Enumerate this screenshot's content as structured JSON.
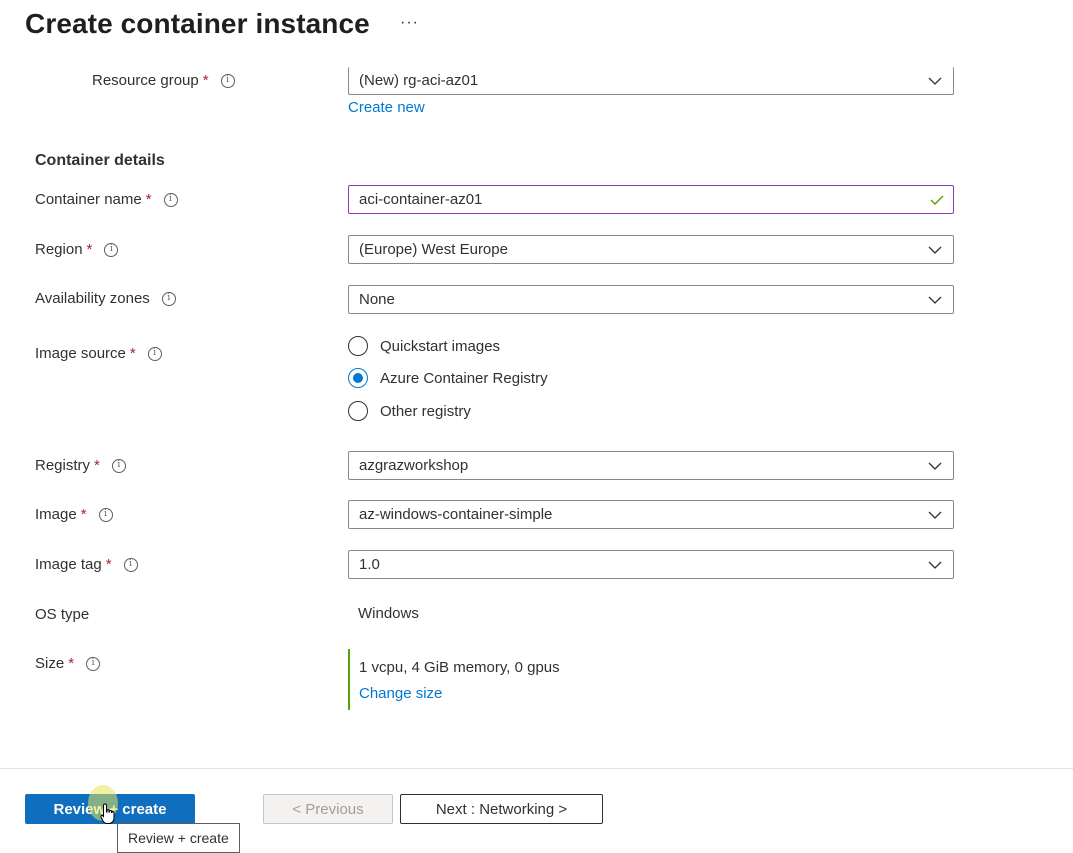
{
  "header": {
    "title": "Create container instance",
    "more_label": "···"
  },
  "project": {
    "resource_group": {
      "label": "Resource group",
      "required": "*",
      "info": "i",
      "value": "(New) rg-aci-az01",
      "create_new_label": "Create new"
    }
  },
  "container_details": {
    "section_title": "Container details",
    "container_name": {
      "label": "Container name",
      "required": "*",
      "info": "i",
      "value": "aci-container-az01",
      "valid": true
    },
    "region": {
      "label": "Region",
      "required": "*",
      "info": "i",
      "value": "(Europe) West Europe"
    },
    "availability_zones": {
      "label": "Availability zones",
      "info": "i",
      "value": "None"
    },
    "image_source": {
      "label": "Image source",
      "required": "*",
      "info": "i",
      "options": [
        {
          "label": "Quickstart images",
          "checked": false
        },
        {
          "label": "Azure Container Registry",
          "checked": true
        },
        {
          "label": "Other registry",
          "checked": false
        }
      ]
    },
    "registry": {
      "label": "Registry",
      "required": "*",
      "info": "i",
      "value": "azgrazworkshop"
    },
    "image": {
      "label": "Image",
      "required": "*",
      "info": "i",
      "value": "az-windows-container-simple"
    },
    "image_tag": {
      "label": "Image tag",
      "required": "*",
      "info": "i",
      "value": "1.0"
    },
    "os_type": {
      "label": "OS type",
      "value": "Windows"
    },
    "size": {
      "label": "Size",
      "required": "*",
      "info": "i",
      "value": "1 vcpu, 4 GiB memory, 0 gpus",
      "change_label": "Change size"
    }
  },
  "footer": {
    "review_create_label": "Review + create",
    "previous_label": "< Previous",
    "next_label": "Next : Networking >",
    "tooltip": "Review + create"
  },
  "colors": {
    "accent": "#0078d4",
    "primary_button": "#106ebe",
    "required": "#a4262c",
    "valid_check": "#57a300",
    "focus_border": "#8c3bb5"
  }
}
